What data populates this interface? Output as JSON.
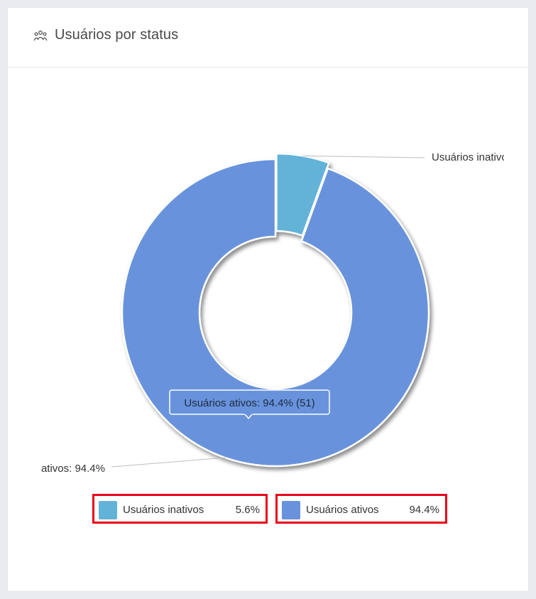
{
  "card": {
    "title": "Usuários por status",
    "icon": "group-icon"
  },
  "chart_data": {
    "type": "pie",
    "donut": true,
    "slices": [
      {
        "label": "Usuários inativos",
        "value": 3,
        "percent": 5.6,
        "color": "#63b3d9"
      },
      {
        "label": "Usuários ativos",
        "value": 51,
        "percent": 94.4,
        "color": "#6893dc"
      }
    ],
    "callouts": [
      {
        "text": "Usuários inativo"
      },
      {
        "text": "ativos: 94.4%"
      }
    ],
    "tooltip": {
      "text": "Usuários ativos: 94.4% (51)"
    }
  },
  "legend": [
    {
      "label": "Usuários inativos",
      "value": "5.6%",
      "color": "#63b3d9"
    },
    {
      "label": "Usuários ativos",
      "value": "94.4%",
      "color": "#6893dc"
    }
  ]
}
